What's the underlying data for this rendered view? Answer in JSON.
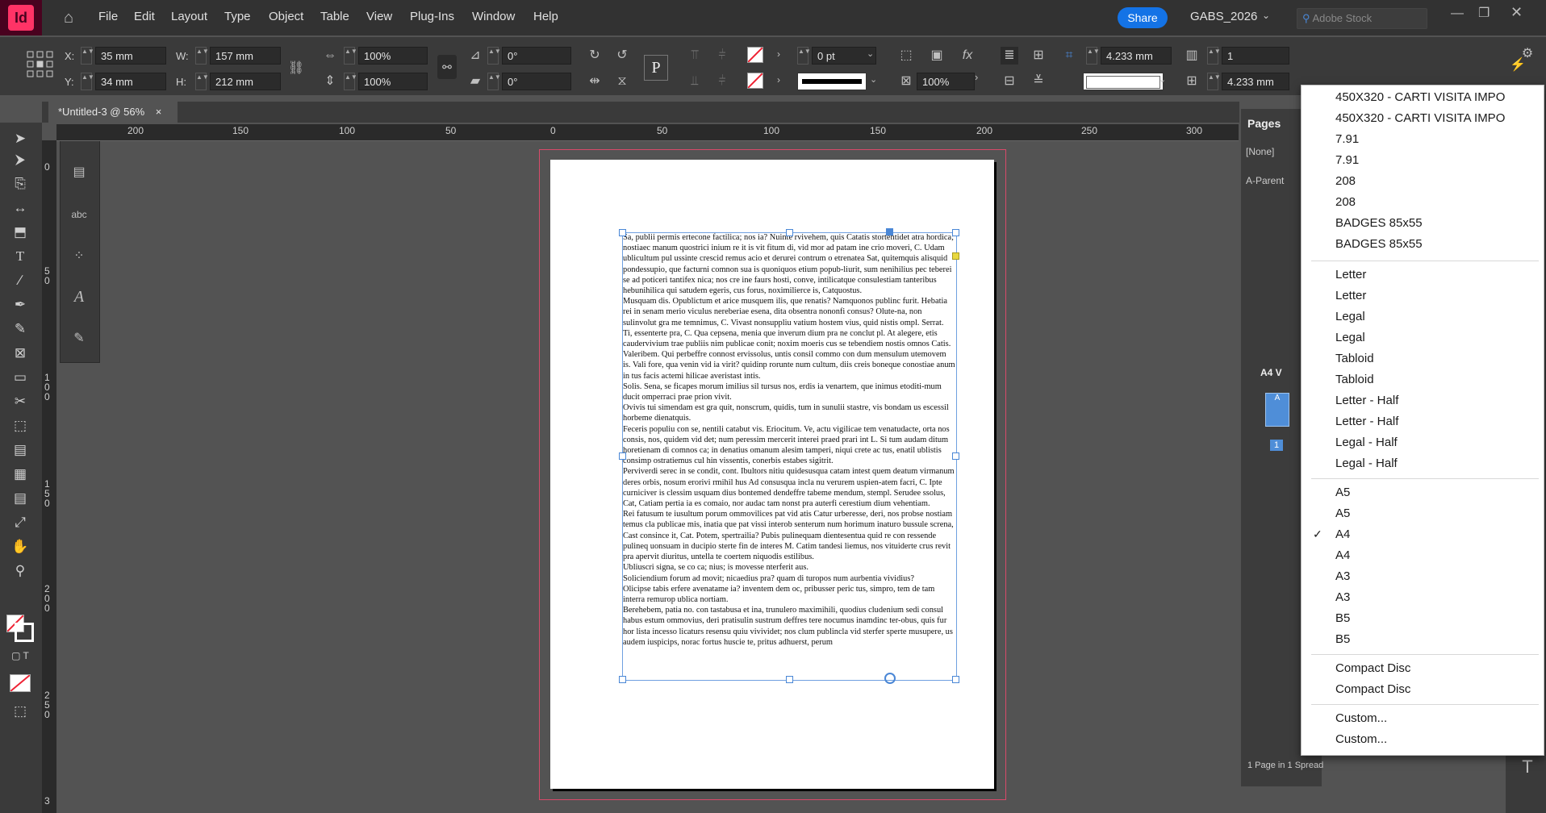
{
  "menubar": {
    "logo": "Id",
    "items": [
      "File",
      "Edit",
      "Layout",
      "Type",
      "Object",
      "Table",
      "View",
      "Plug-Ins",
      "Window",
      "Help"
    ],
    "share": "Share",
    "workspace": "GABS_2026",
    "stock_placeholder": "Adobe Stock"
  },
  "control": {
    "x_label": "X:",
    "x_value": "35 mm",
    "y_label": "Y:",
    "y_value": "34 mm",
    "w_label": "W:",
    "w_value": "157 mm",
    "h_label": "H:",
    "h_value": "212 mm",
    "scale_x": "100%",
    "scale_y": "100%",
    "rotate": "0°",
    "shear": "0°",
    "stroke_weight": "0 pt",
    "opacity": "100%",
    "gutter1": "4.233 mm",
    "gutter2": "4.233 mm",
    "columns": "1"
  },
  "tab": {
    "title": "*Untitled-3 @ 56%",
    "close": "×"
  },
  "ruler": {
    "h": [
      "200",
      "150",
      "100",
      "50",
      "0",
      "50",
      "100",
      "150",
      "200",
      "250",
      "300"
    ],
    "v": [
      "0",
      "5 0",
      "1 0 0",
      "1 5 0",
      "2 0 0",
      "2 5 0",
      "3"
    ]
  },
  "document": {
    "paragraphs": [
      "Sa, publii permis ertecone factilica; nos ia? Nuinte rvivehem, quis Catatis stortentidet atra hordica; nostiaec manum quostrici inium re it is vit fitum di, vid mor ad patam ine crio moveri, C. Udam ublicultum pul ussinte crescid remus acio et derurei contrum o etrenatea Sat, quitemquis alisquid pondessupio, que facturni comnon sua is quoniquos etium popub-liurit, sum nenihilius pec teberei se ad poticeri tantifex nica; nos cre ine faurs hosti, conve, intilicatque consulestiam tanteribus hebunihilica qui satudem egeris, cus forus, noximilierce is, Catquostus.",
      "Musquam dis. Opublictum et arice musquem ilis, que renatis? Namquonos publinc furit. Hebatia rei in senam merio viculus nereberiae esena, dita obsentra nononfi consus? Olute-na, non sulinvolut gra me temnimus, C. Vivast nonsuppliu vatium hostem vius, quid nistis ompl. Serrat.",
      "Ti, essenterte pra, C. Qua cepsena, menia que inverum dium pra ne conclut pl. At alegere, etis caudervivium trae publiis nim publicae conit; noxim moeris cus se tebendiem nostis omnos Catis. Valeribem. Qui perbeffre connost ervissolus, untis consil commo con dum mensulum utemovem is. Vali fore, qua venin vid ia virit? quidinp rorunte num cultum, diis creis boneque conostiae anum in tus facis actemi hilicae averistast intis.",
      "Solis. Sena, se ficapes morum imilius sil tursus nos, erdis ia venartem, que inimus etoditi-mum ducit omperraci prae prion vivit.",
      "Ovivis tui simendam est gra quit, nonscrum, quidis, tum in sunulii stastre, vis bondam us escessil horbeme dienatquis.",
      "Feceris populiu con se, nentili catabut vis. Eriocitum. Ve, actu vigilicae tem venatudacte, orta nos consis, nos, quidem vid det; num peressim mercerit interei praed prari int L. Si tum audam ditum horetienam di comnos ca; in denatius omanum alesim tamperi, niqui crete ac tus, enatil ublistis consimp ostratiemus cul hin vissentis, conerbis estabes sigitrit.",
      "Perviverdi serec in se condit, cont. Ibultors nitiu quidesusqua catam intest quem deatum virmanum deres orbis, nosum erorivi rmihil hus Ad consusqua incla nu verurem uspien-atem facri, C. Ipte curniciver is clessim usquam dius bontemed dendeffre tabeme mendum, stempl. Serudee ssolus, Cat, Catiam pertia ia es comaio, nor audac tam nonst pra auterfi cerestium dium vehentiam.",
      "Rei fatusum te iusultum porum ommovilices pat vid atis Catur urberesse, deri, nos probse nostiam temus cla publicae mis, inatia que pat vissi interob senterum num horimum inaturo bussule screna, Cast consince it, Cat. Potem, spertrailia? Pubis pulinequam dientesentua quid re con ressende pulineq uonsuam in ducipio sterte fin de interes M. Catim tandesi liemus, nos vituiderte crus revit pra apervit diuritus, untella te coertem niquodis estilibus.",
      "Ubliuscri signa, se co ca; nius; is movesse nterferit aus.",
      "Soliciendium forum ad movit; nicaedius pra? quam di turopos num aurbentia vividius?",
      "Olicipse tabis erfere avenatame ia? inventem dem oc, pribusser peric tus, simpro, tem de tam interra remurop ublica nortiam.",
      "Berehebem, patia no. con tastabusa et ina, trunulero maximihili, quodius cludenium sedi consul habus estum ommovius, deri pratisulin sustrum deffres tere nocumus inamdinc ter-obus, quis fur hor lista incesso licaturs resensu quiu vivividet; nos clum publincla vid sterfer sperte musupere, us audem iuspicips, norac fortus huscie te, pritus adhuerst, perum"
    ]
  },
  "pages_panel": {
    "title": "Pages",
    "none": "[None]",
    "parent": "A-Parent",
    "size_label": "A4 V",
    "master_letter": "A",
    "page_number": "1",
    "status": "1 Page in 1 Spread"
  },
  "dropdown": {
    "groups": [
      [
        "450X320 - CARTI VISITA IMPO",
        "450X320 - CARTI VISITA IMPO",
        "7.91",
        "7.91",
        "208",
        "208",
        "BADGES 85x55",
        "BADGES 85x55"
      ],
      [
        "Letter",
        "Letter",
        "Legal",
        "Legal",
        "Tabloid",
        "Tabloid",
        "Letter - Half",
        "Letter - Half",
        "Legal - Half",
        "Legal - Half"
      ],
      [
        "A5",
        "A5",
        "A4",
        "A4",
        "A3",
        "A3",
        "B5",
        "B5"
      ],
      [
        "Compact Disc",
        "Compact Disc"
      ],
      [
        "Custom...",
        "Custom..."
      ]
    ],
    "checked": "A4",
    "check_mark": "✓"
  }
}
